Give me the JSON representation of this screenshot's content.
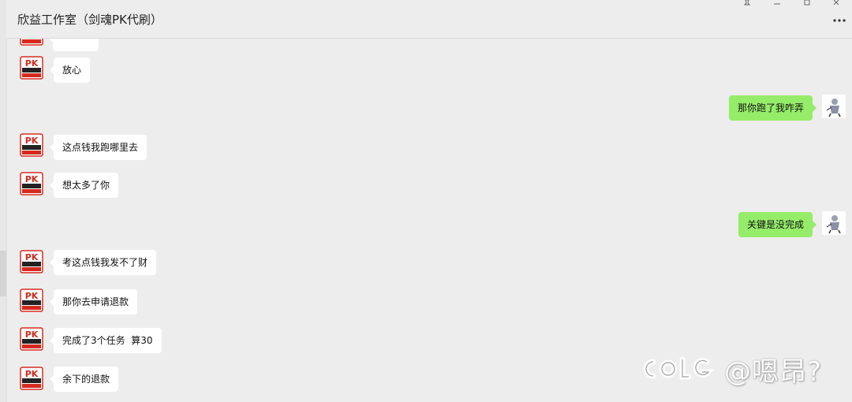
{
  "header": {
    "title": "欣益工作室（剑魂PK代刷）",
    "window_controls": [
      "pin-icon",
      "minimize-icon",
      "maximize-icon",
      "close-icon"
    ],
    "more_icon": "more-dots-icon"
  },
  "colors": {
    "background": "#ededed",
    "incoming_bubble": "#ffffff",
    "outgoing_bubble": "#95ec69",
    "shop_avatar_red": "#d42a1e"
  },
  "messages": [
    {
      "side": "in",
      "text": ""
    },
    {
      "side": "in",
      "text": "放心"
    },
    {
      "side": "out",
      "text": "那你跑了我咋弄"
    },
    {
      "side": "in",
      "text": "这点钱我跑哪里去"
    },
    {
      "side": "in",
      "text": "想太多了你"
    },
    {
      "side": "out",
      "text": "关键是没完成"
    },
    {
      "side": "in",
      "text": "考这点钱我发不了财"
    },
    {
      "side": "in",
      "text": "那你去申请退款"
    },
    {
      "side": "in",
      "text": "完成了3个任务  算30"
    },
    {
      "side": "in",
      "text": "余下的退款"
    }
  ],
  "avatars": {
    "shop_logo_text": "PK",
    "shop_logo_icon": "pk-shop-logo-icon",
    "user_avatar_icon": "anime-character-avatar-icon"
  },
  "watermark": {
    "logo": "colg-logo",
    "text": "@嗯昂?"
  }
}
